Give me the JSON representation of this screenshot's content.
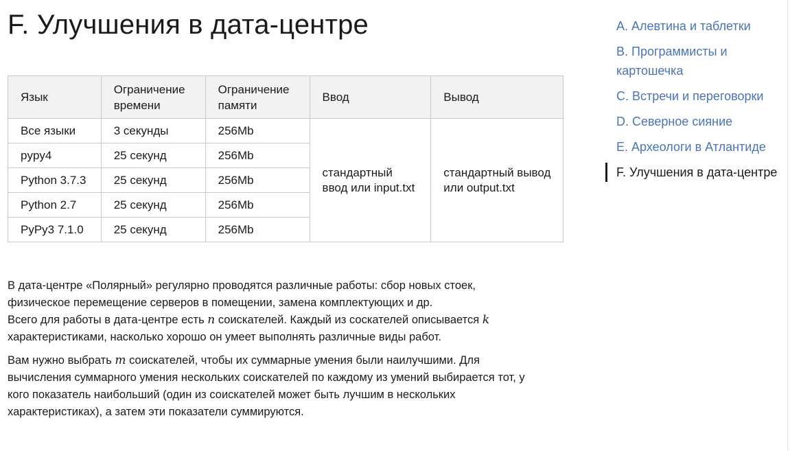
{
  "page": {
    "title": "F. Улучшения в дата-центре"
  },
  "limits_table": {
    "headers": [
      "Язык",
      "Ограничение времени",
      "Ограничение памяти",
      "Ввод",
      "Вывод"
    ],
    "rows": [
      {
        "lang": "Все языки",
        "time": "3 секунды",
        "memory": "256Mb"
      },
      {
        "lang": "pypy4",
        "time": "25 секунд",
        "memory": "256Mb"
      },
      {
        "lang": "Python 3.7.3",
        "time": "25 секунд",
        "memory": "256Mb"
      },
      {
        "lang": "Python 2.7",
        "time": "25 секунд",
        "memory": "256Mb"
      },
      {
        "lang": "PyPy3 7.1.0",
        "time": "25 секунд",
        "memory": "256Mb"
      }
    ],
    "input": "стандартный ввод или input.txt",
    "output": "стандартный вывод или output.txt"
  },
  "statement": {
    "p1_line1": "В дата-центре «Полярный» регулярно проводятся различные работы: сбор новых стоек, физическое перемещение серверов в помещении, замена комплектующих и др.",
    "p1_line2_a": "Всего для работы в дата-центре есть ",
    "var_n": "n",
    "p1_line2_b": " соискателей. Каждый из соскателей описывается ",
    "var_k": "k",
    "p1_line2_c": " характеристиками, насколько хорошо он умеет выполнять различные виды работ.",
    "p2_a": "Вам нужно выбрать ",
    "var_m": "m",
    "p2_b": " соискателей, чтобы их суммарные умения были наилучшими. Для вычисления суммарного умения нескольких соискателей по каждому из умений выбирается тот, у кого показатель наибольший (один из соискателей может быть лучшим в нескольких характеристиках), а затем эти показатели суммируются."
  },
  "nav": {
    "items": [
      {
        "label": "A. Алевтина и таблетки"
      },
      {
        "label": "B. Программисты и картошечка"
      },
      {
        "label": "C. Встречи и переговорки"
      },
      {
        "label": "D. Северное сияние"
      },
      {
        "label": "E. Археологи в Атлантиде"
      },
      {
        "label": "F. Улучшения в дата-центре",
        "active": true
      }
    ]
  },
  "colors": {
    "link": "#4a73b8",
    "text": "#1a1a1a",
    "table_header_bg": "#f2f2f2",
    "table_border": "#c9c9c9"
  }
}
